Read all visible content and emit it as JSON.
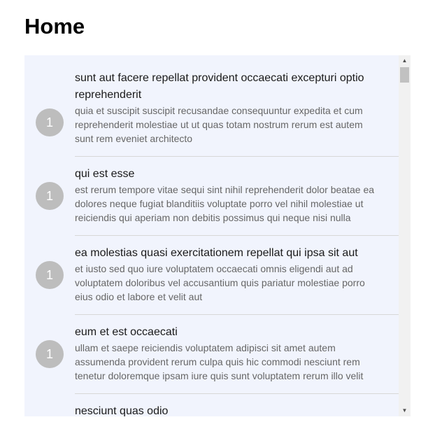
{
  "header": {
    "title": "Home"
  },
  "list": {
    "items": [
      {
        "avatar": "1",
        "title": "sunt aut facere repellat provident occaecati excepturi optio reprehenderit",
        "body": "quia et suscipit suscipit recusandae consequuntur expedita et cum reprehenderit molestiae ut ut quas totam nostrum rerum est autem sunt rem eveniet architecto"
      },
      {
        "avatar": "1",
        "title": "qui est esse",
        "body": "est rerum tempore vitae sequi sint nihil reprehenderit dolor beatae ea dolores neque fugiat blanditiis voluptate porro vel nihil molestiae ut reiciendis qui aperiam non debitis possimus qui neque nisi nulla"
      },
      {
        "avatar": "1",
        "title": "ea molestias quasi exercitationem repellat qui ipsa sit aut",
        "body": "et iusto sed quo iure voluptatem occaecati omnis eligendi aut ad voluptatem doloribus vel accusantium quis pariatur molestiae porro eius odio et labore et velit aut"
      },
      {
        "avatar": "1",
        "title": "eum et est occaecati",
        "body": "ullam et saepe reiciendis voluptatem adipisci sit amet autem assumenda provident rerum culpa quis hic commodi nesciunt rem tenetur doloremque ipsam iure quis sunt voluptatem rerum illo velit"
      },
      {
        "avatar": "",
        "title": "nesciunt quas odio",
        "body": ""
      }
    ]
  },
  "scrollbar": {
    "up_icon": "scroll-up-arrow",
    "down_icon": "scroll-down-arrow",
    "up_glyph": "▲",
    "down_glyph": "▼"
  },
  "colors": {
    "panel_background": "#f1f4fd",
    "avatar_background": "#bdbdbd",
    "divider": "#d7d7d7"
  }
}
